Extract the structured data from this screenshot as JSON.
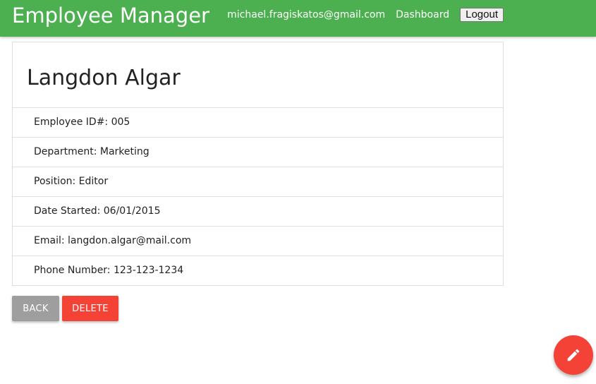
{
  "navbar": {
    "brand": "Employee Manager",
    "user_email": "michael.fragiskatos@gmail.com",
    "dashboard_label": "Dashboard",
    "logout_label": "Logout",
    "color": "#4caf50"
  },
  "employee": {
    "name": "Langdon Algar",
    "details": [
      {
        "text": "Employee ID#: 005"
      },
      {
        "text": "Department: Marketing"
      },
      {
        "text": "Position: Editor"
      },
      {
        "text": "Date Started: 06/01/2015"
      },
      {
        "text": "Email: langdon.algar@mail.com"
      },
      {
        "text": "Phone Number: 123-123-1234"
      }
    ]
  },
  "actions": {
    "back_label": "Back",
    "delete_label": "Delete",
    "back_color": "#9e9e9e",
    "delete_color": "#f44336",
    "fab_icon": "pencil-icon"
  }
}
